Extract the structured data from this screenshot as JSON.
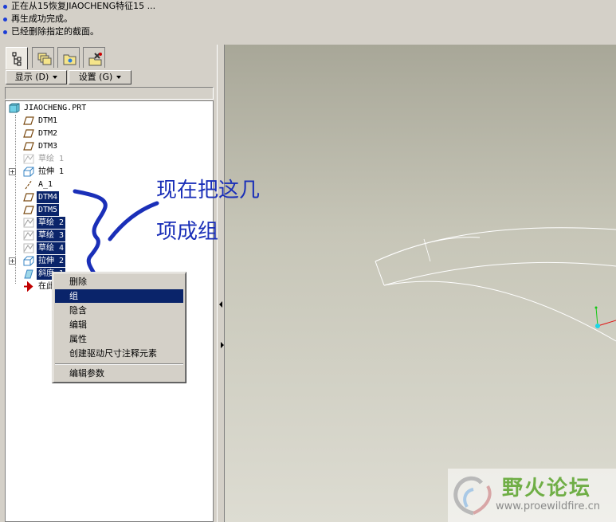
{
  "messages": [
    "正在从15恢复JIAOCHENG特征15 ...",
    "再生成功完成。",
    "已经删除指定的截面。"
  ],
  "panel": {
    "tabs": [
      "model-tree-icon",
      "layer-icon",
      "folder-browser-icon",
      "tools-icon"
    ],
    "display_menu": "显示 (D)",
    "settings_menu": "设置 (G)"
  },
  "tree": [
    {
      "label": "JIAOCHENG.PRT",
      "icon": "part-icon",
      "state": "normal"
    },
    {
      "label": "DTM1",
      "icon": "datum-plane-icon",
      "state": "normal"
    },
    {
      "label": "DTM2",
      "icon": "datum-plane-icon",
      "state": "normal"
    },
    {
      "label": "DTM3",
      "icon": "datum-plane-icon",
      "state": "normal"
    },
    {
      "label": "草绘 1",
      "icon": "sketch-icon",
      "state": "dim"
    },
    {
      "label": "拉伸 1",
      "icon": "extrude-icon",
      "state": "normal",
      "expandable": true
    },
    {
      "label": "A_1",
      "icon": "datum-axis-icon",
      "state": "normal"
    },
    {
      "label": "DTM4",
      "icon": "datum-plane-icon",
      "state": "selected"
    },
    {
      "label": "DTM5",
      "icon": "datum-plane-icon",
      "state": "selected"
    },
    {
      "label": "草绘 2",
      "icon": "sketch-icon",
      "state": "selected"
    },
    {
      "label": "草绘 3",
      "icon": "sketch-icon",
      "state": "selected"
    },
    {
      "label": "草绘 4",
      "icon": "sketch-icon",
      "state": "selected"
    },
    {
      "label": "拉伸 2",
      "icon": "extrude-icon",
      "state": "selected",
      "expandable": true
    },
    {
      "label": "斜度 1",
      "icon": "draft-icon",
      "state": "selected"
    },
    {
      "label": "在此插入",
      "icon": "insert-here-arrow-icon",
      "state": "normal"
    }
  ],
  "context_menu": {
    "items": [
      "删除",
      "组",
      "隐含",
      "编辑",
      "属性",
      "创建驱动尺寸注释元素"
    ],
    "highlighted": "组",
    "after_separator": [
      "编辑参数"
    ]
  },
  "annotation": {
    "line1": "现在把这几",
    "line2": "项成组"
  },
  "watermark": {
    "title": "野火论坛",
    "url": "www.proewildfire.cn"
  },
  "colors": {
    "selection": "#0a246a",
    "annotation": "#1a2fb8",
    "watermark": "#6fae46"
  }
}
